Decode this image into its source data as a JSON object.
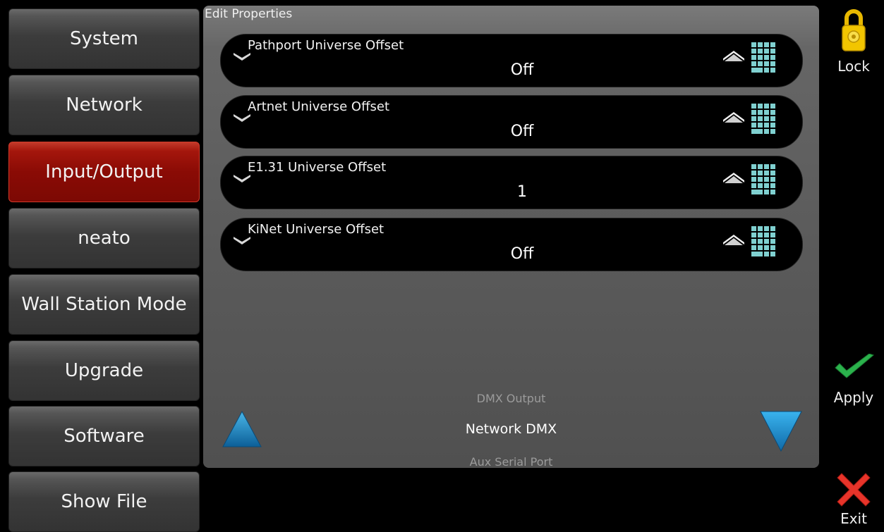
{
  "sidebar": {
    "items": [
      {
        "label": "System",
        "active": false
      },
      {
        "label": "Network",
        "active": false
      },
      {
        "label": "Input/Output",
        "active": true
      },
      {
        "label": "neato",
        "active": false
      },
      {
        "label": "Wall Station Mode",
        "active": false
      },
      {
        "label": "Upgrade",
        "active": false
      },
      {
        "label": "Software",
        "active": false
      },
      {
        "label": "Show File",
        "active": false
      }
    ]
  },
  "panel": {
    "title": "Edit Properties",
    "properties": [
      {
        "label": "Pathport Universe Offset",
        "value": "Off"
      },
      {
        "label": "Artnet Universe Offset",
        "value": "Off"
      },
      {
        "label": "E1.31 Universe Offset",
        "value": "1"
      },
      {
        "label": "KiNet Universe Offset",
        "value": "Off"
      }
    ],
    "selector": {
      "previous": "DMX Output",
      "current": "Network DMX",
      "next": "Aux Serial Port"
    }
  },
  "actions": {
    "lock_label": "Lock",
    "apply_label": "Apply",
    "exit_label": "Exit"
  },
  "colors": {
    "active_tab": "#8a0b05",
    "lock": "#f2c500",
    "apply": "#2bb24c",
    "exit": "#e8342a",
    "arrows": "#1e88c8"
  }
}
